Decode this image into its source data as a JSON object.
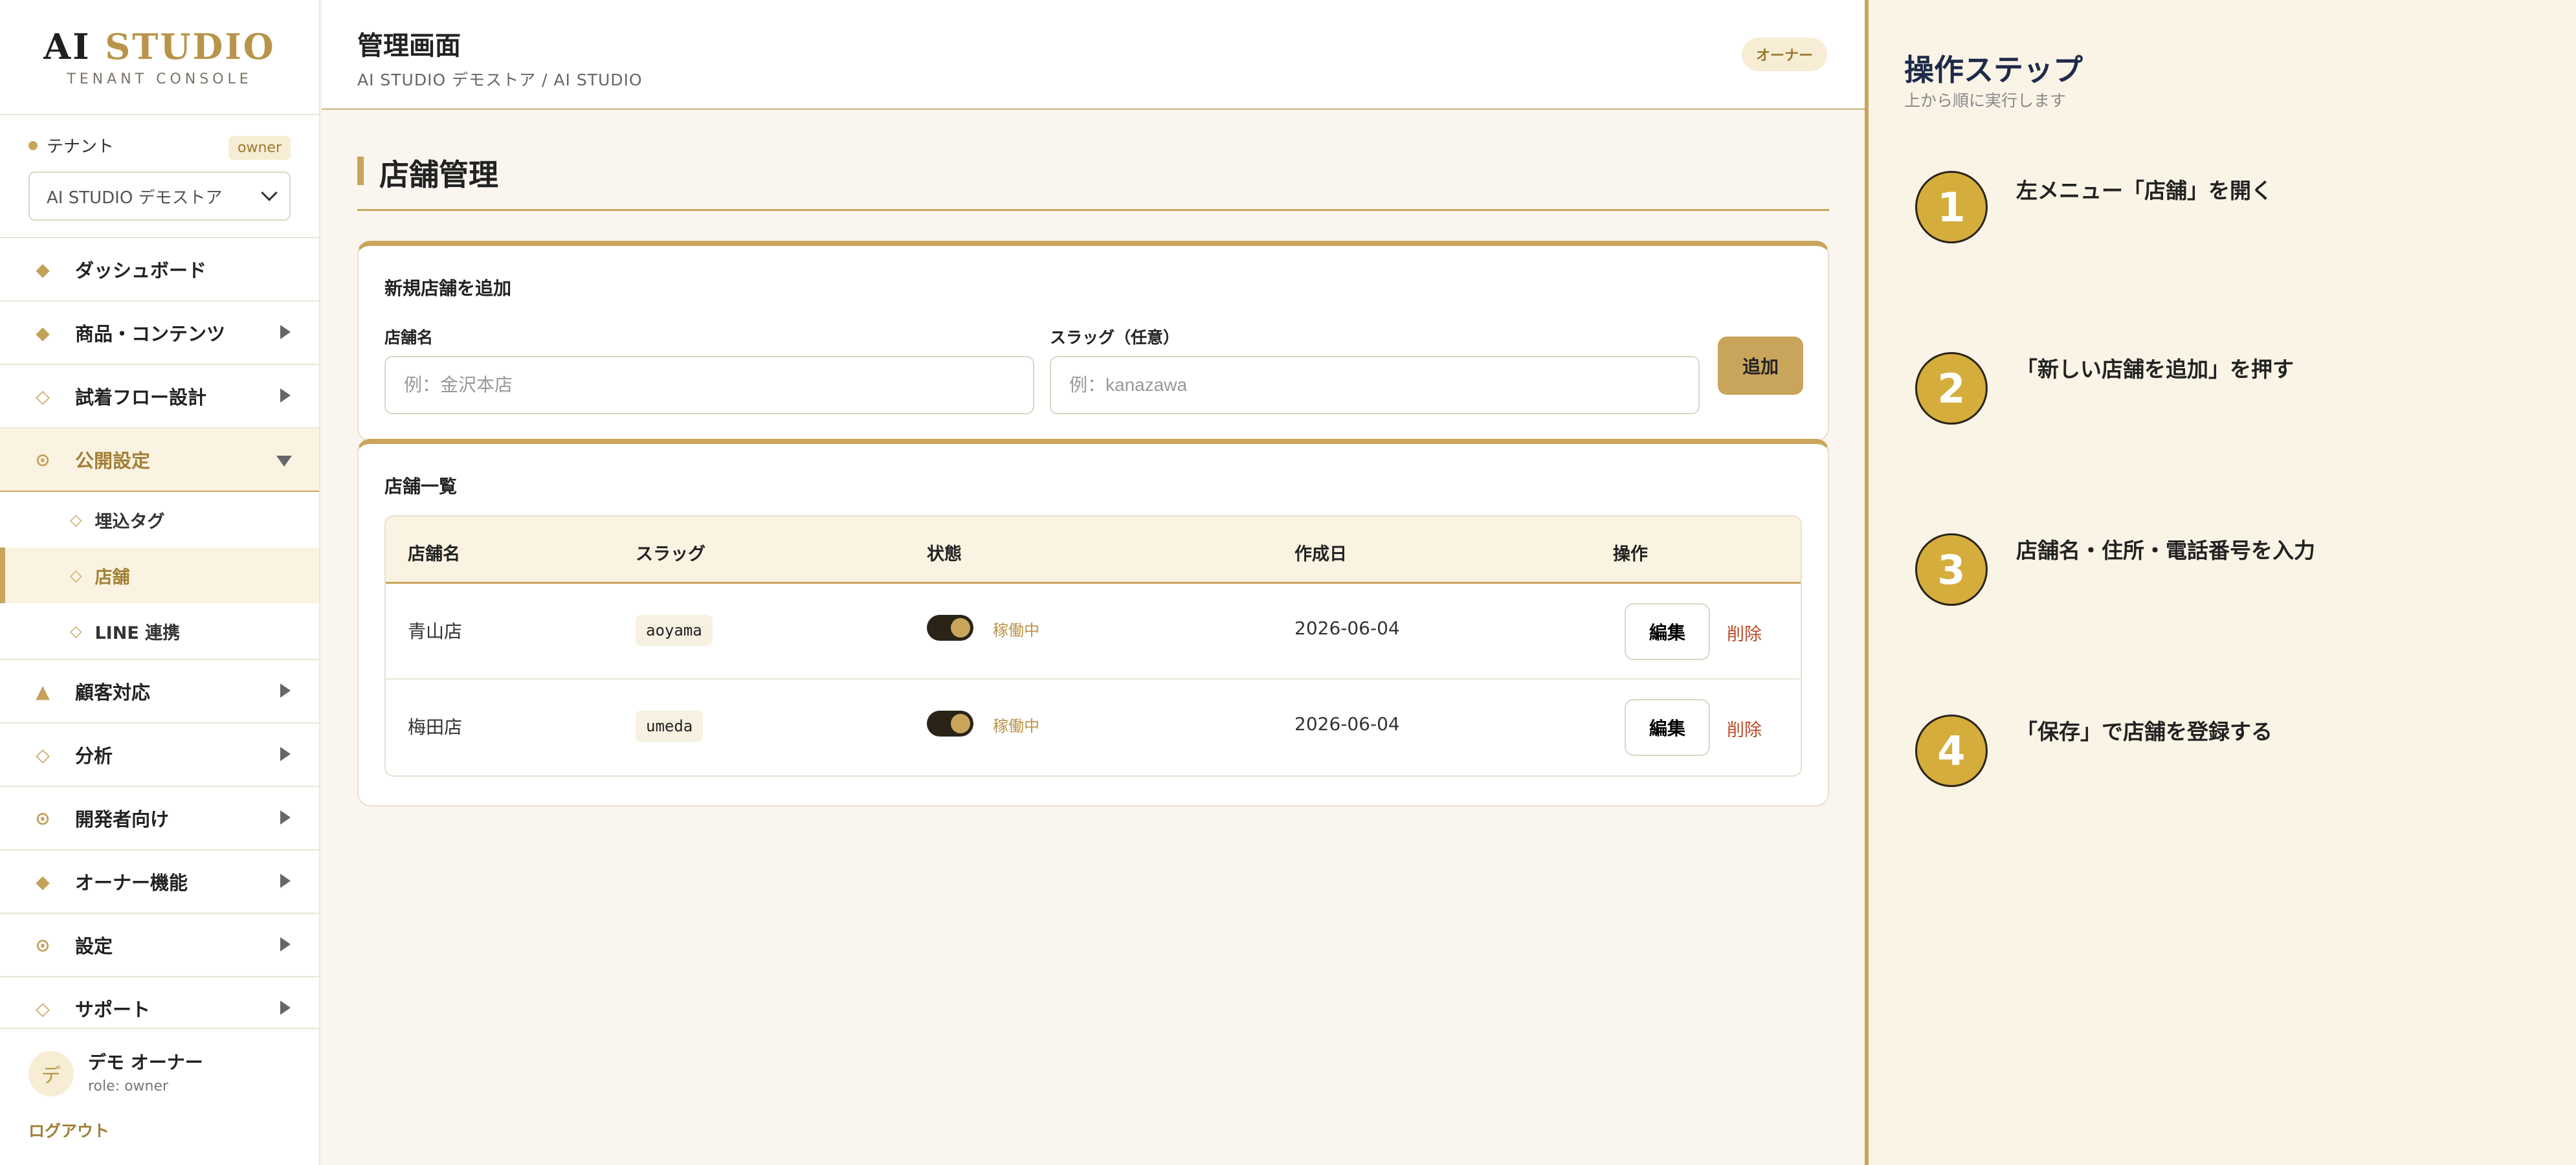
{
  "brand": {
    "title_main": "AI",
    "title_accent": "STUDIO",
    "subtitle": "TENANT CONSOLE"
  },
  "tenant": {
    "label": "テナント",
    "badge": "owner",
    "selected": "AI STUDIO デモストア"
  },
  "nav": {
    "dashboard": "ダッシュボード",
    "products": "商品・コンテンツ",
    "tryon_flow": "試着フロー設計",
    "publish": "公開設定",
    "publish_children": {
      "embed": "埋込タグ",
      "stores": "店舗",
      "line": "LINE 連携"
    },
    "customer": "顧客対応",
    "analytics": "分析",
    "developer": "開発者向け",
    "owner": "オーナー機能",
    "settings": "設定",
    "support": "サポート"
  },
  "user": {
    "avatar_char": "デ",
    "name": "デモ オーナー",
    "role": "role: owner",
    "logout": "ログアウト"
  },
  "header": {
    "title": "管理画面",
    "breadcrumb": "AI STUDIO デモストア / AI STUDIO",
    "role_pill": "オーナー"
  },
  "page": {
    "title": "店舗管理"
  },
  "add_form": {
    "title": "新規店舗を追加",
    "name_label": "店舗名",
    "name_placeholder": "例：金沢本店",
    "slug_label": "スラッグ（任意）",
    "slug_placeholder": "例：kanazawa",
    "submit": "追加"
  },
  "store_list": {
    "title": "店舗一覧",
    "columns": {
      "name": "店舗名",
      "slug": "スラッグ",
      "status": "状態",
      "created": "作成日",
      "actions": "操作"
    },
    "rows": [
      {
        "name": "青山店",
        "slug": "aoyama",
        "status": "稼働中",
        "active": true,
        "created": "2026-06-04",
        "edit": "編集",
        "delete": "削除"
      },
      {
        "name": "梅田店",
        "slug": "umeda",
        "status": "稼働中",
        "active": true,
        "created": "2026-06-04",
        "edit": "編集",
        "delete": "削除"
      }
    ]
  },
  "guide": {
    "title": "操作ステップ",
    "subtitle": "上から順に実行します",
    "steps": [
      {
        "num": "1",
        "text": "左メニュー「店舗」を開く"
      },
      {
        "num": "2",
        "text": "「新しい店舗を追加」を押す"
      },
      {
        "num": "3",
        "text": "店舗名・住所・電話番号を入力"
      },
      {
        "num": "4",
        "text": "「保存」で店舗を登録する"
      }
    ]
  },
  "colors": {
    "accent": "#c9a55c",
    "accent_text": "#a17f36",
    "danger": "#b94b2a",
    "guide_title": "#1e2a4a",
    "step_circle": "#d4ad3c"
  },
  "icons": {
    "dashboard": "diamond-filled-icon",
    "products": "diamond-filled-icon",
    "tryon_flow": "diamond-outline-icon",
    "publish": "circle-dot-icon",
    "customer": "triangle-icon",
    "analytics": "diamond-outline-icon",
    "developer": "circle-dot-icon",
    "owner": "diamond-filled-icon",
    "settings": "circle-dot-icon"
  }
}
